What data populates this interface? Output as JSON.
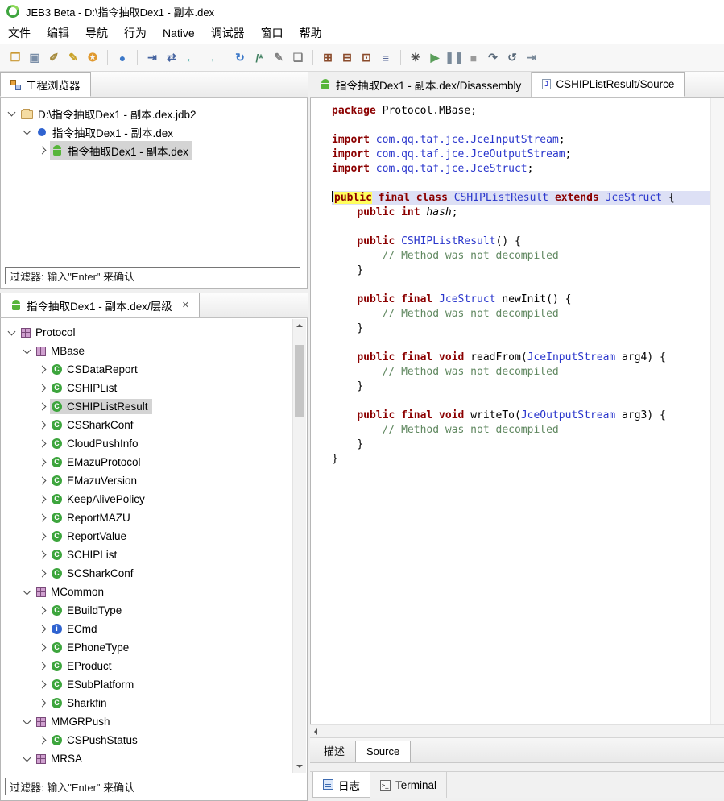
{
  "window": {
    "title": "JEB3 Beta - D:\\指令抽取Dex1 - 副本.dex"
  },
  "menu": {
    "items": [
      "文件",
      "编辑",
      "导航",
      "行为",
      "Native",
      "调试器",
      "窗口",
      "帮助"
    ]
  },
  "toolbar": {
    "icons": [
      {
        "name": "open-folder-icon",
        "glyph": "❒",
        "color": "#c99833"
      },
      {
        "name": "save-icon",
        "glyph": "▣",
        "color": "#7b8fa8"
      },
      {
        "name": "tools-icon",
        "glyph": "✐",
        "color": "#a58a3c"
      },
      {
        "name": "pen-icon",
        "glyph": "✎",
        "color": "#c9a227"
      },
      {
        "name": "lock-icon",
        "glyph": "✪",
        "color": "#e0992f"
      },
      {
        "sep": true
      },
      {
        "name": "globe-icon",
        "glyph": "●",
        "color": "#3c78c8"
      },
      {
        "sep": true
      },
      {
        "name": "goto-address-icon",
        "glyph": "⇥",
        "color": "#4664a0"
      },
      {
        "name": "goto-symbol-icon",
        "glyph": "⇄",
        "color": "#4664a0"
      },
      {
        "name": "back-icon",
        "glyph": "←",
        "color": "#2ba39b"
      },
      {
        "name": "forward-icon",
        "glyph": "→",
        "color": "#8fc7c2"
      },
      {
        "sep": true
      },
      {
        "name": "refresh-icon",
        "glyph": "↻",
        "color": "#3c78c8"
      },
      {
        "name": "comment-icon",
        "glyph": "/*",
        "color": "#3f7f5f"
      },
      {
        "name": "edit-icon",
        "glyph": "✎",
        "color": "#808080"
      },
      {
        "name": "rename-icon",
        "glyph": "❏",
        "color": "#808080"
      },
      {
        "sep": true
      },
      {
        "name": "bytecode-view-icon",
        "glyph": "⊞",
        "color": "#8a4a2a"
      },
      {
        "name": "decompile-icon",
        "glyph": "⊟",
        "color": "#8a4a2a"
      },
      {
        "name": "hex-view-icon",
        "glyph": "⊡",
        "color": "#8a4a2a"
      },
      {
        "name": "strings-view-icon",
        "glyph": "≡",
        "color": "#5a6a9a"
      },
      {
        "sep": true
      },
      {
        "name": "settings-icon",
        "glyph": "✳",
        "color": "#444444"
      },
      {
        "name": "run-icon",
        "glyph": "▶",
        "color": "#5a9e5a"
      },
      {
        "name": "pause-icon",
        "glyph": "❚❚",
        "color": "#7a8a9a"
      },
      {
        "name": "stop-icon",
        "glyph": "■",
        "color": "#9a9a9a"
      },
      {
        "name": "step-over-icon",
        "glyph": "↷",
        "color": "#5a6a7a"
      },
      {
        "name": "restart-icon",
        "glyph": "↺",
        "color": "#5a6a7a"
      },
      {
        "name": "attach-icon",
        "glyph": "⇥",
        "color": "#7a8a9a"
      }
    ]
  },
  "project": {
    "tab_label": "工程浏览器",
    "filter": "过滤器: 输入\"Enter\" 来确认",
    "tree": [
      {
        "indent": 0,
        "exp": "open",
        "icon": "db",
        "label": "D:\\指令抽取Dex1 - 副本.dex.jdb2",
        "selected": false
      },
      {
        "indent": 1,
        "exp": "open",
        "icon": "dot",
        "label": "指令抽取Dex1 - 副本.dex",
        "selected": false
      },
      {
        "indent": 2,
        "exp": "closed",
        "icon": "android",
        "label": "指令抽取Dex1 - 副本.dex",
        "selected": true
      }
    ]
  },
  "hierarchy": {
    "tab_label": "指令抽取Dex1 - 副本.dex/层级",
    "filter": "过滤器: 输入\"Enter\" 来确认",
    "tree": [
      {
        "indent": 0,
        "exp": "open",
        "icon": "pkg",
        "label": "Protocol",
        "selected": false
      },
      {
        "indent": 1,
        "exp": "open",
        "icon": "pkg",
        "label": "MBase",
        "selected": false
      },
      {
        "indent": 2,
        "exp": "closed",
        "icon": "cls",
        "label": "CSDataReport",
        "selected": false
      },
      {
        "indent": 2,
        "exp": "closed",
        "icon": "cls",
        "label": "CSHIPList",
        "selected": false
      },
      {
        "indent": 2,
        "exp": "closed",
        "icon": "cls",
        "label": "CSHIPListResult",
        "selected": true
      },
      {
        "indent": 2,
        "exp": "closed",
        "icon": "cls",
        "label": "CSSharkConf",
        "selected": false
      },
      {
        "indent": 2,
        "exp": "closed",
        "icon": "cls",
        "label": "CloudPushInfo",
        "selected": false
      },
      {
        "indent": 2,
        "exp": "closed",
        "icon": "cls",
        "label": "EMazuProtocol",
        "selected": false
      },
      {
        "indent": 2,
        "exp": "closed",
        "icon": "cls",
        "label": "EMazuVersion",
        "selected": false
      },
      {
        "indent": 2,
        "exp": "closed",
        "icon": "cls",
        "label": "KeepAlivePolicy",
        "selected": false
      },
      {
        "indent": 2,
        "exp": "closed",
        "icon": "cls",
        "label": "ReportMAZU",
        "selected": false
      },
      {
        "indent": 2,
        "exp": "closed",
        "icon": "cls",
        "label": "ReportValue",
        "selected": false
      },
      {
        "indent": 2,
        "exp": "closed",
        "icon": "cls",
        "label": "SCHIPList",
        "selected": false
      },
      {
        "indent": 2,
        "exp": "closed",
        "icon": "cls",
        "label": "SCSharkConf",
        "selected": false
      },
      {
        "indent": 1,
        "exp": "open",
        "icon": "pkg",
        "label": "MCommon",
        "selected": false
      },
      {
        "indent": 2,
        "exp": "closed",
        "icon": "cls",
        "label": "EBuildType",
        "selected": false
      },
      {
        "indent": 2,
        "exp": "closed",
        "icon": "icls",
        "label": "ECmd",
        "selected": false
      },
      {
        "indent": 2,
        "exp": "closed",
        "icon": "cls",
        "label": "EPhoneType",
        "selected": false
      },
      {
        "indent": 2,
        "exp": "closed",
        "icon": "cls",
        "label": "EProduct",
        "selected": false
      },
      {
        "indent": 2,
        "exp": "closed",
        "icon": "cls",
        "label": "ESubPlatform",
        "selected": false
      },
      {
        "indent": 2,
        "exp": "closed",
        "icon": "cls",
        "label": "Sharkfin",
        "selected": false
      },
      {
        "indent": 1,
        "exp": "open",
        "icon": "pkg",
        "label": "MMGRPush",
        "selected": false
      },
      {
        "indent": 2,
        "exp": "closed",
        "icon": "cls",
        "label": "CSPushStatus",
        "selected": false
      },
      {
        "indent": 1,
        "exp": "open",
        "icon": "pkg",
        "label": "MRSA",
        "selected": false
      }
    ]
  },
  "editor": {
    "tabs": [
      {
        "label": "指令抽取Dex1 - 副本.dex/Disassembly",
        "active": false
      },
      {
        "label": "CSHIPListResult/Source",
        "active": true
      }
    ],
    "bottom_tabs": [
      {
        "label": "描述",
        "active": false
      },
      {
        "label": "Source",
        "active": true
      }
    ],
    "code_lines": [
      {
        "tokens": [
          {
            "t": "package ",
            "c": "kw"
          },
          {
            "t": "Protocol.MBase;",
            "c": "plain"
          }
        ]
      },
      {
        "tokens": []
      },
      {
        "tokens": [
          {
            "t": "import ",
            "c": "kw"
          },
          {
            "t": "com.qq.taf.jce.JceInputStream",
            "c": "type"
          },
          {
            "t": ";",
            "c": "plain"
          }
        ]
      },
      {
        "tokens": [
          {
            "t": "import ",
            "c": "kw"
          },
          {
            "t": "com.qq.taf.jce.JceOutputStream",
            "c": "type"
          },
          {
            "t": ";",
            "c": "plain"
          }
        ]
      },
      {
        "tokens": [
          {
            "t": "import ",
            "c": "kw"
          },
          {
            "t": "com.qq.taf.jce.JceStruct",
            "c": "type"
          },
          {
            "t": ";",
            "c": "plain"
          }
        ]
      },
      {
        "tokens": []
      },
      {
        "current": true,
        "caret": true,
        "tokens": [
          {
            "t": "public",
            "c": "kw",
            "mark": true
          },
          {
            "t": " ",
            "c": "plain"
          },
          {
            "t": "final class",
            "c": "kw"
          },
          {
            "t": " ",
            "c": "plain"
          },
          {
            "t": "CSHIPListResult",
            "c": "type"
          },
          {
            "t": " ",
            "c": "plain"
          },
          {
            "t": "extends",
            "c": "kw"
          },
          {
            "t": " ",
            "c": "plain"
          },
          {
            "t": "JceStruct",
            "c": "type"
          },
          {
            "t": " {",
            "c": "plain"
          }
        ]
      },
      {
        "tokens": [
          {
            "t": "    ",
            "c": "plain"
          },
          {
            "t": "public int",
            "c": "kw"
          },
          {
            "t": " ",
            "c": "plain"
          },
          {
            "t": "hash",
            "c": "field"
          },
          {
            "t": ";",
            "c": "plain"
          }
        ]
      },
      {
        "tokens": []
      },
      {
        "tokens": [
          {
            "t": "    ",
            "c": "plain"
          },
          {
            "t": "public",
            "c": "kw"
          },
          {
            "t": " ",
            "c": "plain"
          },
          {
            "t": "CSHIPListResult",
            "c": "type"
          },
          {
            "t": "() {",
            "c": "plain"
          }
        ]
      },
      {
        "tokens": [
          {
            "t": "        // Method was not decompiled",
            "c": "comment"
          }
        ]
      },
      {
        "tokens": [
          {
            "t": "    }",
            "c": "plain"
          }
        ]
      },
      {
        "tokens": []
      },
      {
        "tokens": [
          {
            "t": "    ",
            "c": "plain"
          },
          {
            "t": "public final",
            "c": "kw"
          },
          {
            "t": " ",
            "c": "plain"
          },
          {
            "t": "JceStruct",
            "c": "type"
          },
          {
            "t": " newInit() {",
            "c": "plain"
          }
        ]
      },
      {
        "tokens": [
          {
            "t": "        // Method was not decompiled",
            "c": "comment"
          }
        ]
      },
      {
        "tokens": [
          {
            "t": "    }",
            "c": "plain"
          }
        ]
      },
      {
        "tokens": []
      },
      {
        "tokens": [
          {
            "t": "    ",
            "c": "plain"
          },
          {
            "t": "public final void",
            "c": "kw"
          },
          {
            "t": " readFrom(",
            "c": "plain"
          },
          {
            "t": "JceInputStream",
            "c": "type"
          },
          {
            "t": " arg4) {",
            "c": "plain"
          }
        ]
      },
      {
        "tokens": [
          {
            "t": "        // Method was not decompiled",
            "c": "comment"
          }
        ]
      },
      {
        "tokens": [
          {
            "t": "    }",
            "c": "plain"
          }
        ]
      },
      {
        "tokens": []
      },
      {
        "tokens": [
          {
            "t": "    ",
            "c": "plain"
          },
          {
            "t": "public final void",
            "c": "kw"
          },
          {
            "t": " writeTo(",
            "c": "plain"
          },
          {
            "t": "JceOutputStream",
            "c": "type"
          },
          {
            "t": " arg3) {",
            "c": "plain"
          }
        ]
      },
      {
        "tokens": [
          {
            "t": "        // Method was not decompiled",
            "c": "comment"
          }
        ]
      },
      {
        "tokens": [
          {
            "t": "    }",
            "c": "plain"
          }
        ]
      },
      {
        "tokens": [
          {
            "t": "}",
            "c": "plain"
          }
        ]
      }
    ]
  },
  "statusbar": {
    "items": [
      {
        "label": "日志"
      },
      {
        "label": "Terminal"
      }
    ]
  },
  "colors": {
    "keyword": "#8b0000",
    "type_link": "#2a36cc",
    "comment": "#5f875f",
    "current_line": "#dde0f5",
    "word_highlight": "#ffff5e",
    "selection": "#d4d4d4",
    "android_green": "#57b53a",
    "class_green": "#3da53d"
  }
}
